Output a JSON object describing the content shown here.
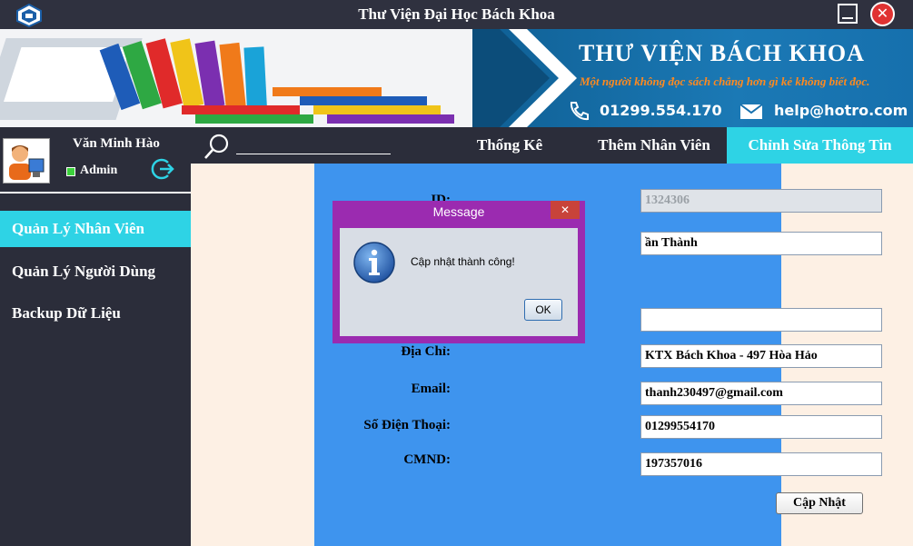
{
  "window": {
    "title": "Thư Viện Đại Học Bách Khoa"
  },
  "banner": {
    "brand": "THƯ VIỆN BÁCH KHOA",
    "slogan": "Một người không đọc sách chẳng hơn gì kẻ không biết đọc.",
    "phone": "01299.554.170",
    "email": "help@hotro.com"
  },
  "user": {
    "name": "Văn Minh Hào",
    "role": "Admin"
  },
  "sidebar": {
    "items": [
      {
        "label": "Quản Lý Nhân Viên",
        "active": true
      },
      {
        "label": "Quản Lý Người Dùng",
        "active": false
      },
      {
        "label": "Backup Dữ Liệu",
        "active": false
      }
    ]
  },
  "topnav": {
    "search_placeholder": "",
    "links": [
      {
        "label": "Thống Kê"
      },
      {
        "label": "Thêm Nhân Viên"
      },
      {
        "label": "Chỉnh Sửa Thông Tin",
        "active": true
      }
    ]
  },
  "form": {
    "id_label": "ID:",
    "id_value": "1324306",
    "name_value": "ần Thành",
    "address_label": "Địa Chỉ:",
    "address_value": "KTX Bách Khoa - 497 Hòa Hảo",
    "email_label": "Email:",
    "email_value": "thanh230497@gmail.com",
    "phone_label": "Số Điện Thoại:",
    "phone_value": "01299554170",
    "cmnd_label": "CMND:",
    "cmnd_value": "197357016",
    "update_label": "Cập Nhật"
  },
  "dialog": {
    "title": "Message",
    "message": "Cập nhật thành công!",
    "ok_label": "OK",
    "close_glyph": "✕"
  },
  "colors": {
    "accent": "#2ed3e5",
    "panel": "#3e94ee",
    "dark": "#2b2d3a",
    "dialog_frame": "#9b2bb0"
  }
}
